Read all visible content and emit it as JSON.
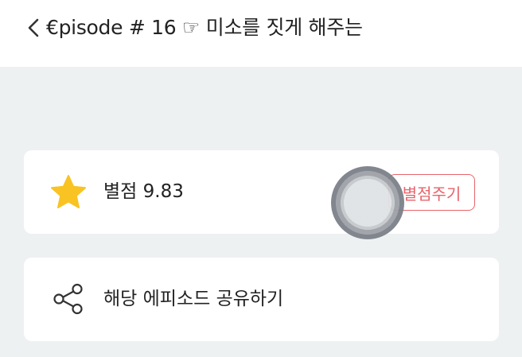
{
  "header": {
    "back_icon": "chevron-left-icon",
    "title": "€pisode # 16 ☞ 미소를 짓게 해주는"
  },
  "rating_card": {
    "icon": "star-icon",
    "icon_color": "#f8c323",
    "label": "별점 9.83",
    "button_label": "별점주기",
    "button_color": "#e8646a"
  },
  "share_card": {
    "icon": "share-icon",
    "label": "해당 에피소드 공유하기"
  }
}
